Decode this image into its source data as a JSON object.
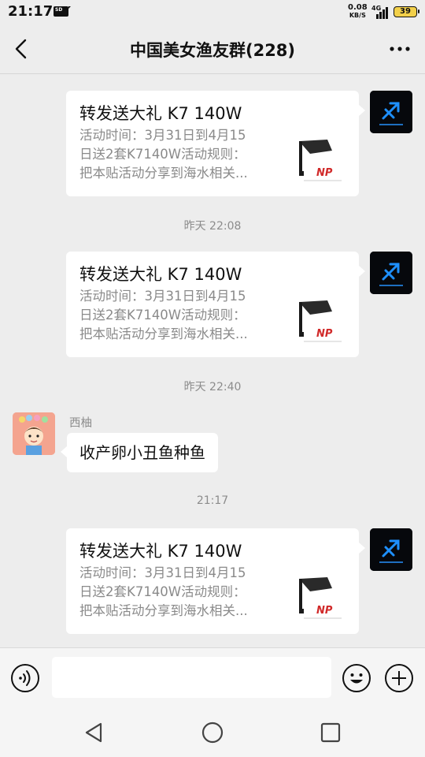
{
  "status_bar": {
    "time": "21:17",
    "sd_label": "SD",
    "net_speed": "0.08",
    "net_unit": "KB/S",
    "network": "4G",
    "battery": "39"
  },
  "header": {
    "title": "中国美女渔友群(228)",
    "back_icon": "chevron-left-icon",
    "more_icon": "more-dots-icon"
  },
  "card": {
    "title": "转发送大礼 K7 140W",
    "desc_lines": [
      "活动时间：3月31日到4月15",
      "日送2套K7140W活动规则：",
      "把本贴活动分享到海水相关..."
    ],
    "logo_text": "NP"
  },
  "timestamps": [
    "昨天 22:08",
    "昨天 22:40",
    "21:17"
  ],
  "text_message": {
    "sender": "西柚",
    "text": "收产卵小丑鱼种鱼"
  },
  "input_bar": {
    "placeholder": "",
    "voice_icon": "voice-icon",
    "emoji_icon": "emoji-icon",
    "plus_icon": "plus-circle-icon"
  },
  "nav_bar": {
    "back_icon": "triangle-back-icon",
    "home_icon": "circle-home-icon",
    "recents_icon": "square-recents-icon"
  },
  "colors": {
    "background": "#ededed",
    "bubble": "#ffffff",
    "muted_text": "#8c8c8c",
    "self_avatar_accent": "#1e90ff"
  }
}
